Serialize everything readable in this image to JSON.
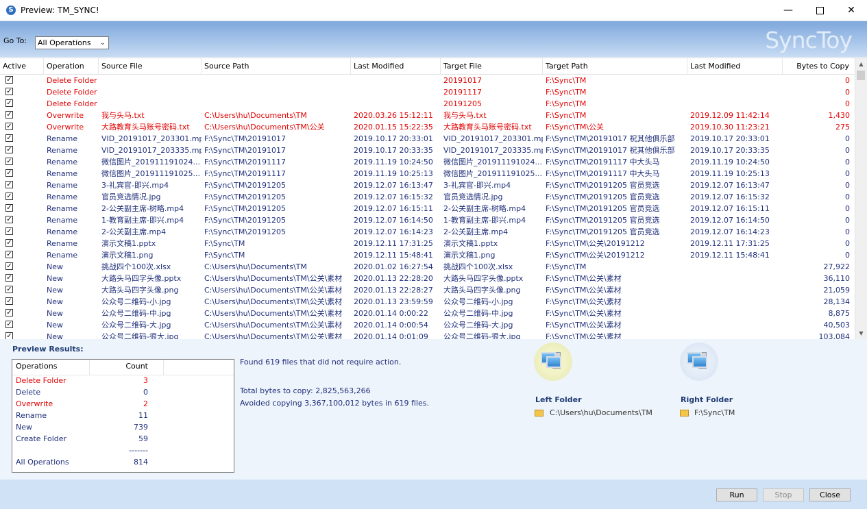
{
  "window": {
    "title": "Preview: TM_SYNC!",
    "icon_glyph": "S"
  },
  "header": {
    "goto_label": "Go To:",
    "goto_value": "All Operations",
    "brand": "SyncToy"
  },
  "table": {
    "columns": [
      "Active",
      "Operation",
      "Source File",
      "Source Path",
      "Last Modified",
      "Target File",
      "Target Path",
      "Last Modified",
      "Bytes to Copy"
    ],
    "rows": [
      {
        "op": "Delete Folder",
        "src_file": "",
        "src_path": "",
        "src_mod": "",
        "tgt_file": "20191017",
        "tgt_path": "F:\\Sync\\TM",
        "tgt_mod": "",
        "bytes": "0",
        "color": "red"
      },
      {
        "op": "Delete Folder",
        "src_file": "",
        "src_path": "",
        "src_mod": "",
        "tgt_file": "20191117",
        "tgt_path": "F:\\Sync\\TM",
        "tgt_mod": "",
        "bytes": "0",
        "color": "red"
      },
      {
        "op": "Delete Folder",
        "src_file": "",
        "src_path": "",
        "src_mod": "",
        "tgt_file": "20191205",
        "tgt_path": "F:\\Sync\\TM",
        "tgt_mod": "",
        "bytes": "0",
        "color": "red"
      },
      {
        "op": "Overwrite",
        "src_file": "我与头马.txt",
        "src_path": "C:\\Users\\hu\\Documents\\TM",
        "src_mod": "2020.03.26 15:12:11",
        "tgt_file": "我与头马.txt",
        "tgt_path": "F:\\Sync\\TM",
        "tgt_mod": "2019.12.09 11:42:14",
        "bytes": "1,430",
        "color": "red"
      },
      {
        "op": "Overwrite",
        "src_file": "大路教育头马账号密码.txt",
        "src_path": "C:\\Users\\hu\\Documents\\TM\\公关",
        "src_mod": "2020.01.15 15:22:35",
        "tgt_file": "大路教育头马账号密码.txt",
        "tgt_path": "F:\\Sync\\TM\\公关",
        "tgt_mod": "2019.10.30 11:23:21",
        "bytes": "275",
        "color": "red"
      },
      {
        "op": "Rename",
        "src_file": "VID_20191017_203301.mp4",
        "src_path": "F:\\Sync\\TM\\20191017",
        "src_mod": "2019.10.17 20:33:01",
        "tgt_file": "VID_20191017_203301.mp4",
        "tgt_path": "F:\\Sync\\TM\\20191017 祝其他俱乐部",
        "tgt_mod": "2019.10.17 20:33:01",
        "bytes": "0",
        "color": "blue"
      },
      {
        "op": "Rename",
        "src_file": "VID_20191017_203335.mp4",
        "src_path": "F:\\Sync\\TM\\20191017",
        "src_mod": "2019.10.17 20:33:35",
        "tgt_file": "VID_20191017_203335.mp4",
        "tgt_path": "F:\\Sync\\TM\\20191017 祝其他俱乐部",
        "tgt_mod": "2019.10.17 20:33:35",
        "bytes": "0",
        "color": "blue"
      },
      {
        "op": "Rename",
        "src_file": "微信图片_201911191024...",
        "src_path": "F:\\Sync\\TM\\20191117",
        "src_mod": "2019.11.19 10:24:50",
        "tgt_file": "微信图片_201911191024...",
        "tgt_path": "F:\\Sync\\TM\\20191117 中大头马",
        "tgt_mod": "2019.11.19 10:24:50",
        "bytes": "0",
        "color": "blue"
      },
      {
        "op": "Rename",
        "src_file": "微信图片_201911191025...",
        "src_path": "F:\\Sync\\TM\\20191117",
        "src_mod": "2019.11.19 10:25:13",
        "tgt_file": "微信图片_201911191025...",
        "tgt_path": "F:\\Sync\\TM\\20191117 中大头马",
        "tgt_mod": "2019.11.19 10:25:13",
        "bytes": "0",
        "color": "blue"
      },
      {
        "op": "Rename",
        "src_file": "3-礼宾官-即兴.mp4",
        "src_path": "F:\\Sync\\TM\\20191205",
        "src_mod": "2019.12.07 16:13:47",
        "tgt_file": "3-礼宾官-即兴.mp4",
        "tgt_path": "F:\\Sync\\TM\\20191205 官员竞选",
        "tgt_mod": "2019.12.07 16:13:47",
        "bytes": "0",
        "color": "blue"
      },
      {
        "op": "Rename",
        "src_file": "官员竞选情况.jpg",
        "src_path": "F:\\Sync\\TM\\20191205",
        "src_mod": "2019.12.07 16:15:32",
        "tgt_file": "官员竞选情况.jpg",
        "tgt_path": "F:\\Sync\\TM\\20191205 官员竞选",
        "tgt_mod": "2019.12.07 16:15:32",
        "bytes": "0",
        "color": "blue"
      },
      {
        "op": "Rename",
        "src_file": "2-公关副主席-树略.mp4",
        "src_path": "F:\\Sync\\TM\\20191205",
        "src_mod": "2019.12.07 16:15:11",
        "tgt_file": "2-公关副主席-树略.mp4",
        "tgt_path": "F:\\Sync\\TM\\20191205 官员竞选",
        "tgt_mod": "2019.12.07 16:15:11",
        "bytes": "0",
        "color": "blue"
      },
      {
        "op": "Rename",
        "src_file": "1-教育副主席-即兴.mp4",
        "src_path": "F:\\Sync\\TM\\20191205",
        "src_mod": "2019.12.07 16:14:50",
        "tgt_file": "1-教育副主席-即兴.mp4",
        "tgt_path": "F:\\Sync\\TM\\20191205 官员竞选",
        "tgt_mod": "2019.12.07 16:14:50",
        "bytes": "0",
        "color": "blue"
      },
      {
        "op": "Rename",
        "src_file": "2-公关副主席.mp4",
        "src_path": "F:\\Sync\\TM\\20191205",
        "src_mod": "2019.12.07 16:14:23",
        "tgt_file": "2-公关副主席.mp4",
        "tgt_path": "F:\\Sync\\TM\\20191205 官员竞选",
        "tgt_mod": "2019.12.07 16:14:23",
        "bytes": "0",
        "color": "blue"
      },
      {
        "op": "Rename",
        "src_file": "演示文稿1.pptx",
        "src_path": "F:\\Sync\\TM",
        "src_mod": "2019.12.11 17:31:25",
        "tgt_file": "演示文稿1.pptx",
        "tgt_path": "F:\\Sync\\TM\\公关\\20191212",
        "tgt_mod": "2019.12.11 17:31:25",
        "bytes": "0",
        "color": "blue"
      },
      {
        "op": "Rename",
        "src_file": "演示文稿1.png",
        "src_path": "F:\\Sync\\TM",
        "src_mod": "2019.12.11 15:48:41",
        "tgt_file": "演示文稿1.png",
        "tgt_path": "F:\\Sync\\TM\\公关\\20191212",
        "tgt_mod": "2019.12.11 15:48:41",
        "bytes": "0",
        "color": "blue"
      },
      {
        "op": "New",
        "src_file": "挑战四个100次.xlsx",
        "src_path": "C:\\Users\\hu\\Documents\\TM",
        "src_mod": "2020.01.02 16:27:54",
        "tgt_file": "挑战四个100次.xlsx",
        "tgt_path": "F:\\Sync\\TM",
        "tgt_mod": "",
        "bytes": "27,922",
        "color": "blue"
      },
      {
        "op": "New",
        "src_file": "大路头马四字头像.pptx",
        "src_path": "C:\\Users\\hu\\Documents\\TM\\公关\\素材",
        "src_mod": "2020.01.13 22:28:20",
        "tgt_file": "大路头马四字头像.pptx",
        "tgt_path": "F:\\Sync\\TM\\公关\\素材",
        "tgt_mod": "",
        "bytes": "36,110",
        "color": "blue"
      },
      {
        "op": "New",
        "src_file": "大路头马四字头像.png",
        "src_path": "C:\\Users\\hu\\Documents\\TM\\公关\\素材",
        "src_mod": "2020.01.13 22:28:27",
        "tgt_file": "大路头马四字头像.png",
        "tgt_path": "F:\\Sync\\TM\\公关\\素材",
        "tgt_mod": "",
        "bytes": "21,059",
        "color": "blue"
      },
      {
        "op": "New",
        "src_file": "公众号二维码-小.jpg",
        "src_path": "C:\\Users\\hu\\Documents\\TM\\公关\\素材",
        "src_mod": "2020.01.13 23:59:59",
        "tgt_file": "公众号二维码-小.jpg",
        "tgt_path": "F:\\Sync\\TM\\公关\\素材",
        "tgt_mod": "",
        "bytes": "28,134",
        "color": "blue"
      },
      {
        "op": "New",
        "src_file": "公众号二维码-中.jpg",
        "src_path": "C:\\Users\\hu\\Documents\\TM\\公关\\素材",
        "src_mod": "2020.01.14 0:00:22",
        "tgt_file": "公众号二维码-中.jpg",
        "tgt_path": "F:\\Sync\\TM\\公关\\素材",
        "tgt_mod": "",
        "bytes": "8,875",
        "color": "blue"
      },
      {
        "op": "New",
        "src_file": "公众号二维码-大.jpg",
        "src_path": "C:\\Users\\hu\\Documents\\TM\\公关\\素材",
        "src_mod": "2020.01.14 0:00:54",
        "tgt_file": "公众号二维码-大.jpg",
        "tgt_path": "F:\\Sync\\TM\\公关\\素材",
        "tgt_mod": "",
        "bytes": "40,503",
        "color": "blue"
      },
      {
        "op": "New",
        "src_file": "公众号二维码-很大.jpg",
        "src_path": "C:\\Users\\hu\\Documents\\TM\\公关\\素材",
        "src_mod": "2020.01.14 0:01:09",
        "tgt_file": "公众号二维码-很大.jpg",
        "tgt_path": "F:\\Sync\\TM\\公关\\素材",
        "tgt_mod": "",
        "bytes": "103,084",
        "color": "blue"
      }
    ]
  },
  "results": {
    "title": "Preview Results:",
    "ops_header": "Operations",
    "count_header": "Count",
    "ops": [
      {
        "label": "Delete Folder",
        "count": "3",
        "color": "red"
      },
      {
        "label": "Delete",
        "count": "0",
        "color": "blue"
      },
      {
        "label": "Overwrite",
        "count": "2",
        "color": "red"
      },
      {
        "label": "Rename",
        "count": "11",
        "color": "blue"
      },
      {
        "label": "New",
        "count": "739",
        "color": "blue"
      },
      {
        "label": "Create Folder",
        "count": "59",
        "color": "blue"
      }
    ],
    "separator": "-------",
    "total_label": "All Operations",
    "total_count": "814",
    "found_text": "Found 619 files that did not require action.",
    "total_bytes_text": "Total bytes to copy: 2,825,563,266",
    "avoided_text": "Avoided copying 3,367,100,012 bytes in 619 files.",
    "left_folder_title": "Left Folder",
    "left_folder_path": "C:\\Users\\hu\\Documents\\TM",
    "right_folder_title": "Right Folder",
    "right_folder_path": "F:\\Sync\\TM"
  },
  "buttons": {
    "run": "Run",
    "stop": "Stop",
    "close": "Close"
  },
  "colors": {
    "red": "#e00000",
    "blue": "#1f2f7a"
  }
}
